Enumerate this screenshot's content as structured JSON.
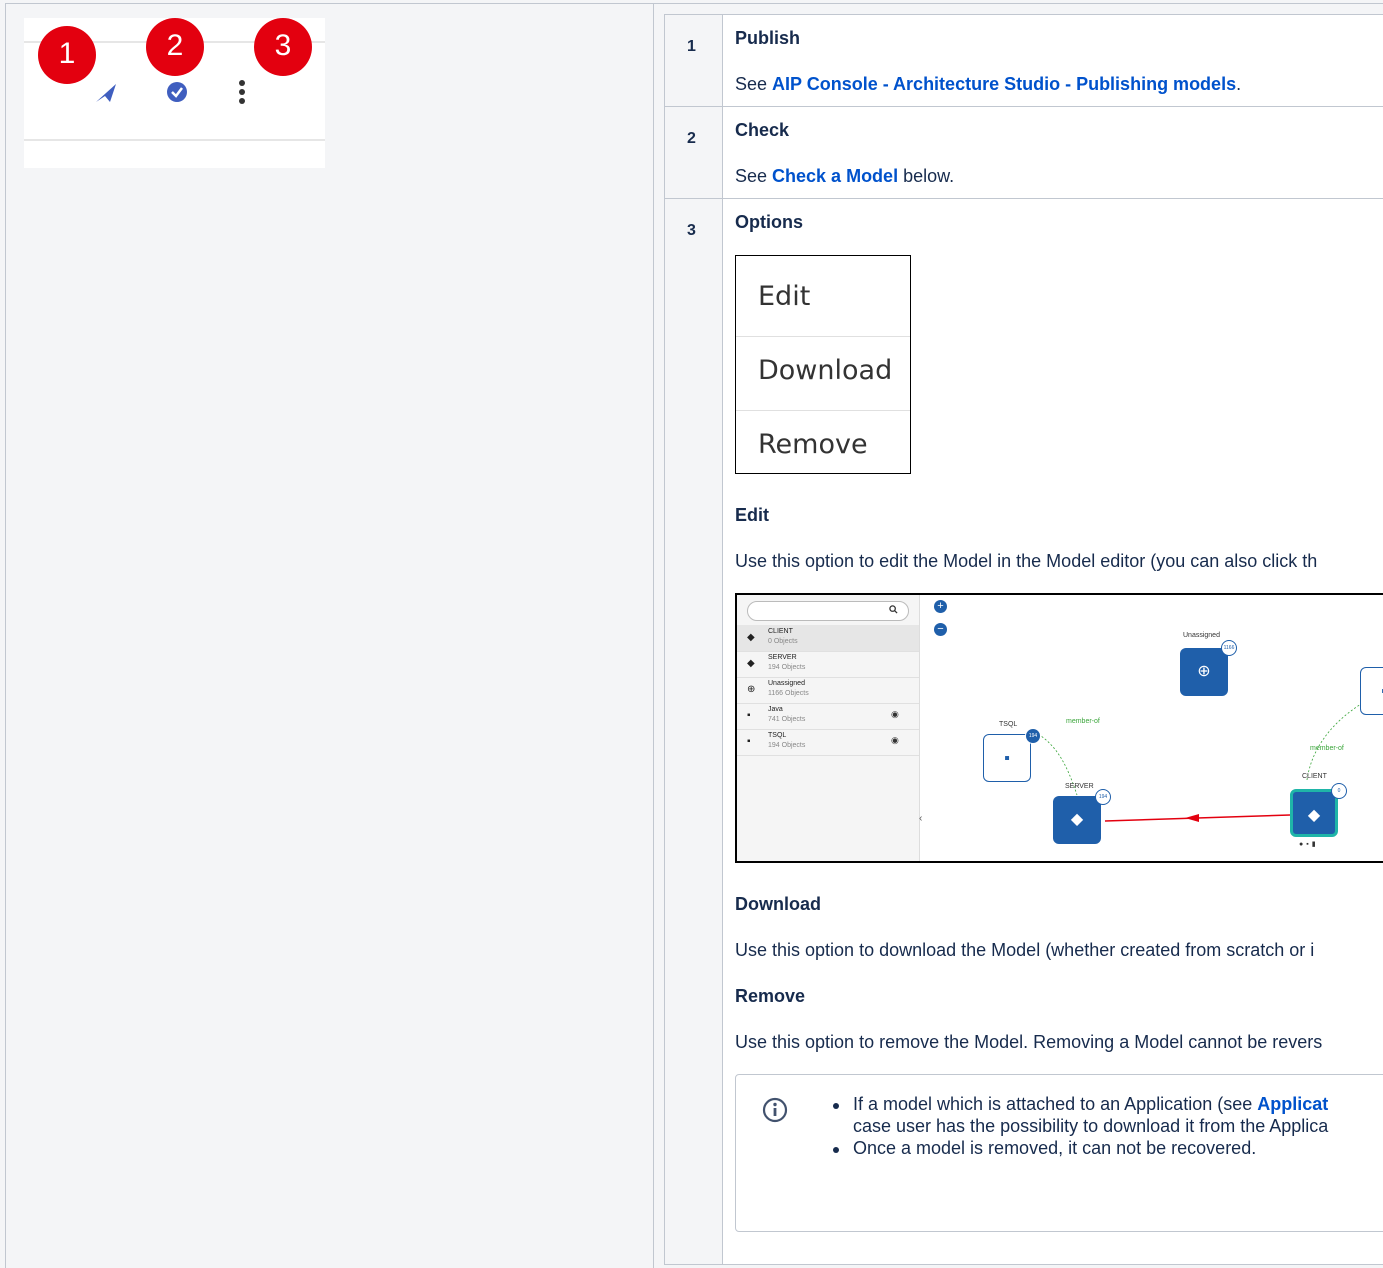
{
  "toolbar_screenshot": {
    "badges": [
      "1",
      "2",
      "3"
    ],
    "icons": [
      "send-icon",
      "check-circle-icon",
      "more-vertical-icon"
    ]
  },
  "rows": [
    {
      "number": "1",
      "title": "Publish",
      "text_prefix": "See ",
      "link_text": "AIP Console - Architecture Studio - Publishing models",
      "text_suffix": "."
    },
    {
      "number": "2",
      "title": "Check",
      "text_prefix": "See ",
      "link_text": "Check a Model",
      "text_suffix": " below."
    },
    {
      "number": "3",
      "title": "Options",
      "menu_items": [
        "Edit",
        "Download",
        "Remove"
      ],
      "edit": {
        "heading": "Edit",
        "text": "Use this option to edit the Model in the Model editor (you can also click th"
      },
      "download": {
        "heading": "Download",
        "text": "Use this option to download the Model (whether created from scratch or i"
      },
      "remove": {
        "heading": "Remove",
        "text": "Use this option to remove the Model. Removing a Model cannot be revers"
      },
      "info": {
        "bullet1_prefix": "If a model which is attached to an Application (see ",
        "bullet1_link": "Applicat",
        "bullet1_line2": "case user has the possibility to download it from the Applica",
        "bullet2": "Once a model is removed, it can not be recovered."
      }
    }
  ],
  "model_editor": {
    "layers": [
      {
        "name": "CLIENT",
        "count": "0 Objects",
        "icon": "layers-icon"
      },
      {
        "name": "SERVER",
        "count": "194 Objects",
        "icon": "layers-icon"
      },
      {
        "name": "Unassigned",
        "count": "1166 Objects",
        "icon": "globe-icon"
      },
      {
        "name": "Java",
        "count": "741 Objects",
        "icon": "widgets-icon"
      },
      {
        "name": "TSQL",
        "count": "194 Objects",
        "icon": "widgets-icon"
      }
    ],
    "zoom_in": "+",
    "zoom_out": "−",
    "nodes": {
      "unassigned": {
        "label": "Unassigned",
        "count": "1166"
      },
      "tsql": {
        "label": "TSQL",
        "count": "194"
      },
      "server": {
        "label": "SERVER",
        "count": "194"
      },
      "client": {
        "label": "CLIENT",
        "count": "0"
      }
    },
    "edge_labels": [
      "member-of",
      "member-of"
    ]
  }
}
